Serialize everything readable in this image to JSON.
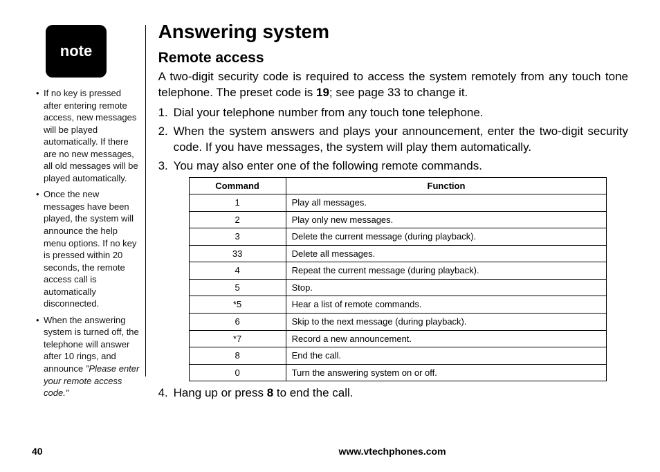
{
  "sidebar": {
    "note_label": "note",
    "bullets": [
      {
        "text": "If no key is pressed after entering remote access, new messages will be played automatically. If there are no new messages, all old messages will be played automatically."
      },
      {
        "text": "Once the new messages have been played, the system will announce the help menu options. If no key is pressed within 20 seconds, the remote access call is automatically disconnected."
      },
      {
        "text": "When the answering system is turned off, the telephone will answer after 10 rings, and announce ",
        "italic_suffix": "\"Please enter your remote access code.\""
      }
    ]
  },
  "main": {
    "title": "Answering system",
    "subtitle": "Remote access",
    "intro_pre": "A two-digit security code is required to access the system remotely from any touch tone telephone. The preset code is ",
    "intro_bold": "19",
    "intro_post": "; see page 33 to change it.",
    "steps": [
      "Dial your telephone number from any touch tone telephone.",
      "When the system answers and plays your announcement, enter the two-digit security code. If you have messages, the system will play them automatically.",
      "You may also enter one of the following remote commands."
    ],
    "step4_pre": "Hang up or press ",
    "step4_bold": "8",
    "step4_post": " to end the call.",
    "table": {
      "headers": {
        "command": "Command",
        "function": "Function"
      },
      "rows": [
        {
          "cmd": "1",
          "fn": "Play all messages."
        },
        {
          "cmd": "2",
          "fn": "Play only new messages."
        },
        {
          "cmd": "3",
          "fn": "Delete the current message (during playback)."
        },
        {
          "cmd": "33",
          "fn": "Delete all messages."
        },
        {
          "cmd": "4",
          "fn": "Repeat the current message (during playback)."
        },
        {
          "cmd": "5",
          "fn": "Stop."
        },
        {
          "cmd": "*5",
          "fn": "Hear a list of remote commands."
        },
        {
          "cmd": "6",
          "fn": "Skip to the next message (during playback)."
        },
        {
          "cmd": "*7",
          "fn": "Record a new announcement."
        },
        {
          "cmd": "8",
          "fn": "End the call."
        },
        {
          "cmd": "0",
          "fn": "Turn the answering system on or off."
        }
      ]
    }
  },
  "footer": {
    "page_number": "40",
    "site": "www.vtechphones.com"
  }
}
